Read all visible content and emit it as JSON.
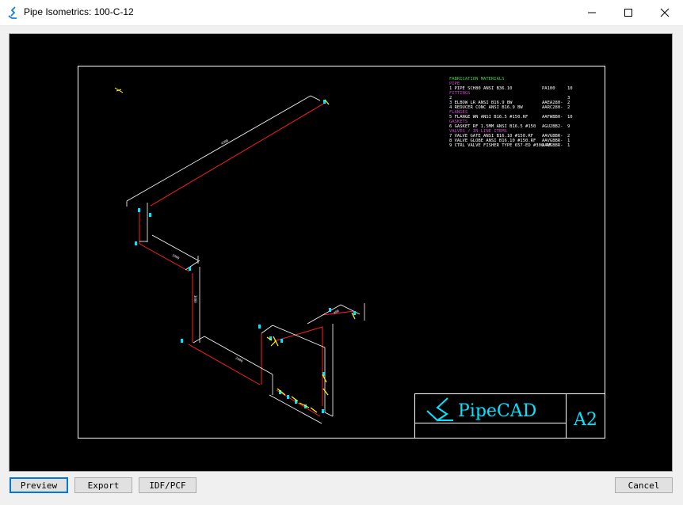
{
  "window": {
    "title": "Pipe Isometrics: 100-C-12"
  },
  "drawing": {
    "bom": {
      "heading": "FABRICATION MATERIALS",
      "sections": {
        "pipe": "PIPE",
        "fittings": "FITTINGS",
        "flanges": "FLANGES",
        "gaskets": "GASKETS",
        "valves": "VALVES / IN-LINE ITEMS"
      },
      "lines": {
        "pipe_1": "1 PIPE SCH80 ANSI B36.10",
        "pipe_1_code": "PA100",
        "pipe_1_qty": "10",
        "fit_2": "2",
        "fit_2_qty": "3",
        "fit_3": "3 ELBOW LR ANSI B16.9 BW",
        "fit_3_code": "AAEA280-",
        "fit_3_qty": "2",
        "fit_4": "4 REDUCER CONC ANSI B16.9 BW",
        "fit_4_code": "AARC280-",
        "fit_4_qty": "2",
        "fla_5": "5 FLANGE WN ANSI B16.5 #150.RF",
        "fla_5_code": "AAFWBB0-",
        "fla_5_qty": "10",
        "gas_6": "6 GASKET RF 1.5MM ANSI B16.5 #150",
        "gas_6_code": "AGU2BB2-",
        "gas_6_qty": "9",
        "val_7": "7 VALVE GATE ANSI B16.10 #150.RF",
        "val_7_code": "AAVGBBR-",
        "val_7_qty": "2",
        "val_8": "8 VALVE GLOBE ANSI B16.10 #150.RF",
        "val_8_code": "AAVGBBR-",
        "val_8_qty": "1",
        "val_9": "9 CTRL VALVE FISHER TYPE 657-ED #300.RF",
        "val_9_code": "AAVGBBR-",
        "val_9_qty": "1"
      }
    },
    "title_block": {
      "brand": "PipeCAD",
      "sheet_size": "A2"
    }
  },
  "buttons": {
    "preview": "Preview",
    "export": "Export",
    "idf_pcf": "IDF/PCF",
    "cancel": "Cancel"
  }
}
